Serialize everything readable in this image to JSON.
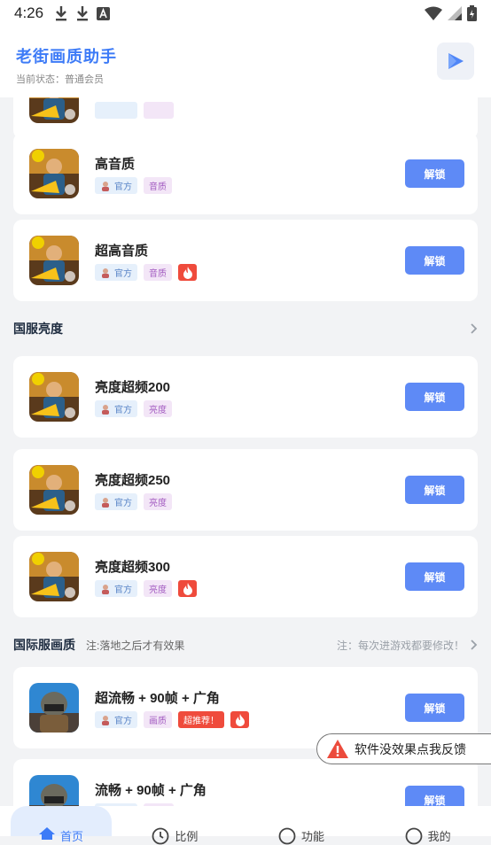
{
  "status_bar": {
    "time": "4:26"
  },
  "header": {
    "title": "老街画质助手",
    "status": "当前状态：普通会员"
  },
  "tags": {
    "official": "官方",
    "recommend": "超推荐！"
  },
  "unlock_label": "解锁",
  "cards_top": [
    {
      "name": "高音质",
      "category": "音质",
      "hot": false
    },
    {
      "name": "超高音质",
      "category": "音质",
      "hot": true
    }
  ],
  "section_brightness": {
    "title": "国服亮度"
  },
  "cards_brightness": [
    {
      "name": "亮度超频200",
      "category": "亮度",
      "hot": false
    },
    {
      "name": "亮度超频250",
      "category": "亮度",
      "hot": false
    },
    {
      "name": "亮度超频300",
      "category": "亮度",
      "hot": true
    }
  ],
  "section_intl": {
    "title": "国际服画质",
    "note": "注:落地之后才有效果",
    "right_note": "注：每次进游戏都要修改！"
  },
  "cards_intl": [
    {
      "name": "超流畅 + 90帧 + 广角",
      "category": "画质",
      "recommend": true,
      "hot": true
    },
    {
      "name": "流畅 + 90帧 + 广角"
    }
  ],
  "feedback": {
    "label": "软件没效果点我反馈"
  },
  "bottom_nav": [
    {
      "label": "首页",
      "active": true
    },
    {
      "label": "比例"
    },
    {
      "label": "功能"
    },
    {
      "label": "我的"
    }
  ],
  "colors": {
    "accent": "#3d7bf7",
    "unlock": "#5e8af6",
    "hot": "#ef4b3c"
  }
}
